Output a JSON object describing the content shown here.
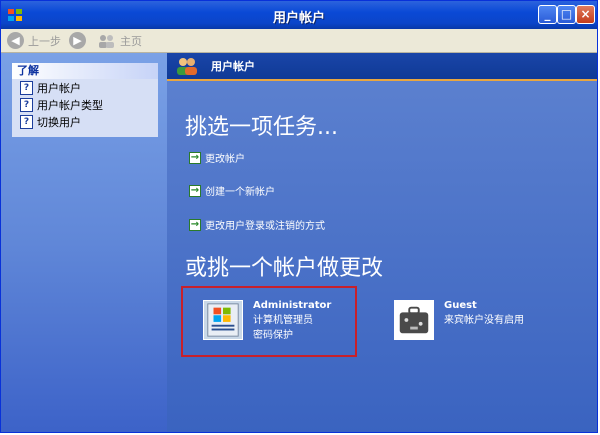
{
  "window": {
    "title": "用户帐户"
  },
  "toolbar": {
    "back_label": "上一步",
    "home_label": "主页"
  },
  "sidebar": {
    "header": "了解",
    "items": [
      {
        "label": "用户帐户"
      },
      {
        "label": "用户帐户类型"
      },
      {
        "label": "切换用户"
      }
    ]
  },
  "header": {
    "title": "用户帐户"
  },
  "main": {
    "task_heading": "挑选一项任务...",
    "tasks": [
      {
        "label": "更改帐户"
      },
      {
        "label": "创建一个新帐户"
      },
      {
        "label": "更改用户登录或注销的方式"
      }
    ],
    "account_heading": "或挑一个帐户做更改",
    "accounts": [
      {
        "name": "Administrator",
        "lines": [
          "计算机管理员",
          "密码保护"
        ]
      },
      {
        "name": "Guest",
        "lines": [
          "来宾帐户没有启用"
        ]
      }
    ]
  },
  "colors": {
    "highlight_border": "#c8202a",
    "title_bar": "#0a49d6"
  }
}
